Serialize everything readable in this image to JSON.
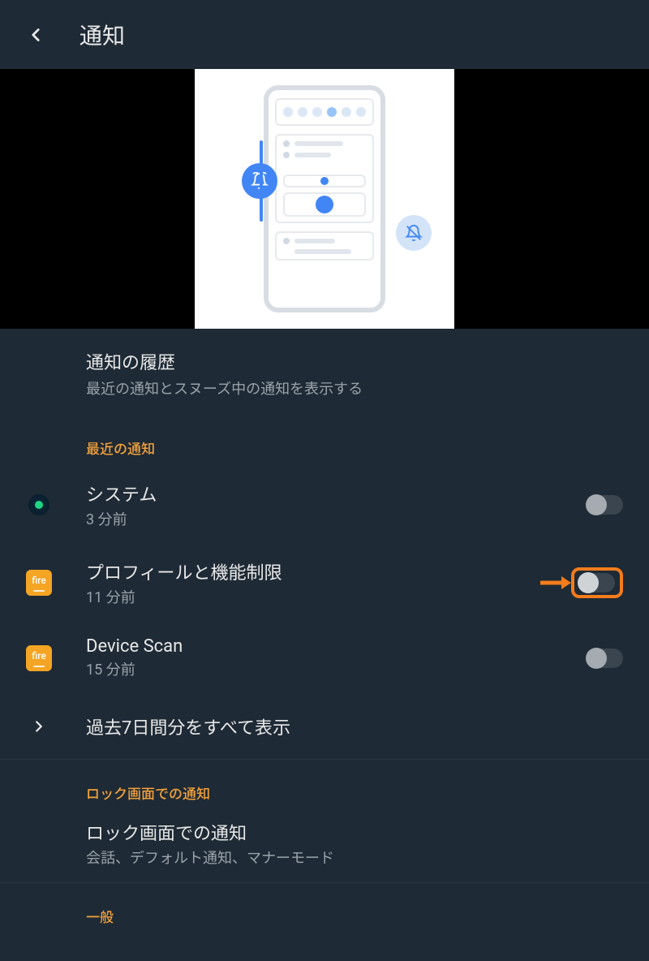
{
  "header": {
    "title": "通知"
  },
  "history": {
    "title": "通知の履歴",
    "subtitle": "最近の通知とスヌーズ中の通知を表示する"
  },
  "recent": {
    "header": "最近の通知",
    "items": [
      {
        "title": "システム",
        "time": "3 分前",
        "icon": "system"
      },
      {
        "title": "プロフィールと機能制限",
        "time": "11 分前",
        "icon": "fire",
        "highlighted": true
      },
      {
        "title": "Device Scan",
        "time": "15 分前",
        "icon": "fire"
      }
    ],
    "showAll": "過去7日間分をすべて表示"
  },
  "lockscreen": {
    "header": "ロック画面での通知",
    "title": "ロック画面での通知",
    "subtitle": "会話、デフォルト通知、マナーモード"
  },
  "general": {
    "header": "一般"
  },
  "icons": {
    "fire_label": "fire"
  }
}
